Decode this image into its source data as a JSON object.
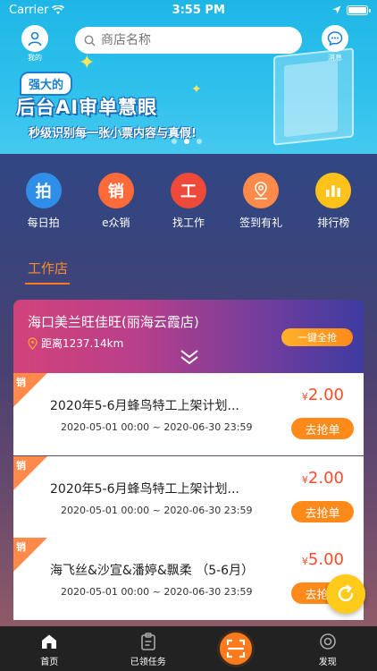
{
  "status_bar": {
    "carrier": "Carrier",
    "time": "3:55 PM"
  },
  "header": {
    "profile_label": "我的",
    "search_placeholder": "商店名称",
    "message_label": "消息"
  },
  "banner": {
    "tag": "强大的",
    "headline": "后台AI审单慧眼",
    "subline": "秒级识别每一张小票内容与真假!",
    "page_count": 3,
    "active_page": 1
  },
  "quick_actions": [
    {
      "icon_text": "拍",
      "label": "每日拍",
      "color": "#2f8fe8"
    },
    {
      "icon_text": "销",
      "label": "e众销",
      "color": "#ff6a3a"
    },
    {
      "icon_text": "工",
      "label": "找工作",
      "color": "#ee4a3a"
    },
    {
      "icon_text": "",
      "label": "签到有礼",
      "color": "#ff8a4a"
    },
    {
      "icon_text": "",
      "label": "排行榜",
      "color": "#ffc21a"
    }
  ],
  "tab": {
    "label": "工作店"
  },
  "store": {
    "name": "海口美兰旺佳旺(丽海云霞店)",
    "distance": "距离1237.14km",
    "grab_all": "一键全抢"
  },
  "tasks": [
    {
      "badge": "销",
      "title": "2020年5-6月蜂鸟特工上架计划...",
      "date": "2020-05-01 00:00 ~ 2020-06-30 23:59",
      "currency": "¥",
      "price": "2.00",
      "button": "去抢单"
    },
    {
      "badge": "销",
      "title": "2020年5-6月蜂鸟特工上架计划...",
      "date": "2020-05-01 00:00 ~ 2020-06-30 23:59",
      "currency": "¥",
      "price": "2.00",
      "button": "去抢单"
    },
    {
      "badge": "销",
      "title": "海飞丝&沙宣&潘婷&飘柔 （5-6月）",
      "date": "2020-05-01 00:00 ~ 2020-06-30 23:59",
      "currency": "¥",
      "price": "5.00",
      "button": "去抢单"
    }
  ],
  "bottom_nav": {
    "home": "首页",
    "tasks": "已领任务",
    "discover": "发现"
  }
}
